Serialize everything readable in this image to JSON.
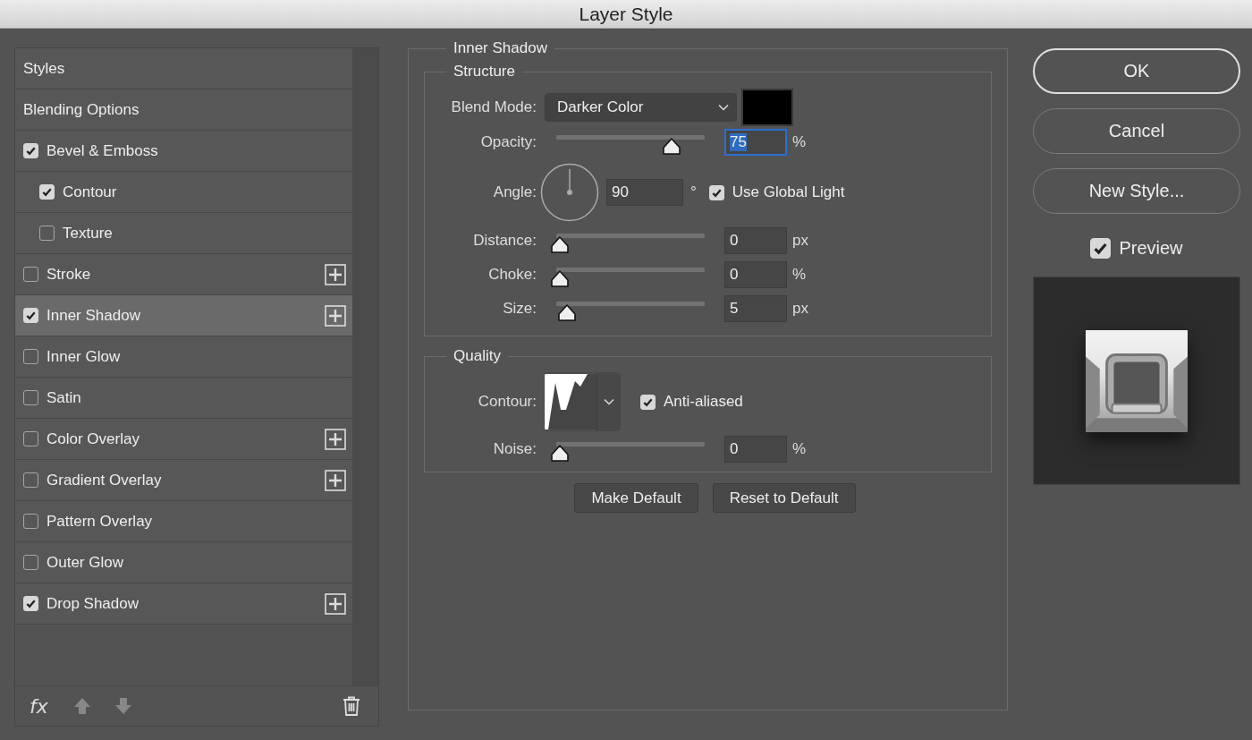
{
  "window": {
    "title": "Layer Style"
  },
  "styles_list": {
    "items": [
      {
        "label": "Styles",
        "kind": "header",
        "selected": false
      },
      {
        "label": "Blending Options",
        "kind": "header",
        "selected": false
      },
      {
        "label": "Bevel & Emboss",
        "kind": "option",
        "checked": true,
        "selected": false,
        "children": [
          {
            "label": "Contour",
            "kind": "option",
            "checked": true,
            "selected": false
          },
          {
            "label": "Texture",
            "kind": "option",
            "checked": false,
            "selected": false
          }
        ]
      },
      {
        "label": "Stroke",
        "kind": "option",
        "checked": false,
        "selected": false,
        "addable": true
      },
      {
        "label": "Inner Shadow",
        "kind": "option",
        "checked": true,
        "selected": true,
        "addable": true
      },
      {
        "label": "Inner Glow",
        "kind": "option",
        "checked": false,
        "selected": false
      },
      {
        "label": "Satin",
        "kind": "option",
        "checked": false,
        "selected": false
      },
      {
        "label": "Color Overlay",
        "kind": "option",
        "checked": false,
        "selected": false,
        "addable": true
      },
      {
        "label": "Gradient Overlay",
        "kind": "option",
        "checked": false,
        "selected": false,
        "addable": true
      },
      {
        "label": "Pattern Overlay",
        "kind": "option",
        "checked": false,
        "selected": false
      },
      {
        "label": "Outer Glow",
        "kind": "option",
        "checked": false,
        "selected": false
      },
      {
        "label": "Drop Shadow",
        "kind": "option",
        "checked": true,
        "selected": false,
        "addable": true
      }
    ]
  },
  "footer": {
    "fx_label": "fx"
  },
  "panel": {
    "title": "Inner Shadow",
    "structure": {
      "legend": "Structure",
      "blend_mode": {
        "label": "Blend Mode:",
        "value": "Darker Color"
      },
      "opacity": {
        "label": "Opacity:",
        "level": 0.75,
        "value": "75",
        "unit": "%",
        "focused": true
      },
      "angle": {
        "label": "Angle:",
        "value": "90",
        "unit": "°"
      },
      "global_light": {
        "label": "Use Global Light",
        "checked": true
      },
      "sliders": [
        {
          "label": "Distance:",
          "level": 0,
          "value": "0",
          "unit": "px",
          "focused": false
        },
        {
          "label": "Choke:",
          "level": 0,
          "value": "0",
          "unit": "%",
          "focused": false
        },
        {
          "label": "Size:",
          "level": 0.05,
          "value": "5",
          "unit": "px",
          "focused": false
        }
      ]
    },
    "quality": {
      "legend": "Quality",
      "contour": {
        "label": "Contour:"
      },
      "anti_aliased": {
        "label": "Anti-aliased",
        "checked": true
      },
      "noise": {
        "label": "Noise:",
        "level": 0,
        "value": "0",
        "unit": "%",
        "focused": false
      }
    },
    "buttons": [
      "Make Default",
      "Reset to Default"
    ]
  },
  "actions": [
    {
      "label": "OK",
      "default": true
    },
    {
      "label": "Cancel",
      "default": false
    },
    {
      "label": "New Style...",
      "default": false
    }
  ],
  "preview": {
    "label": "Preview",
    "checked": true
  }
}
